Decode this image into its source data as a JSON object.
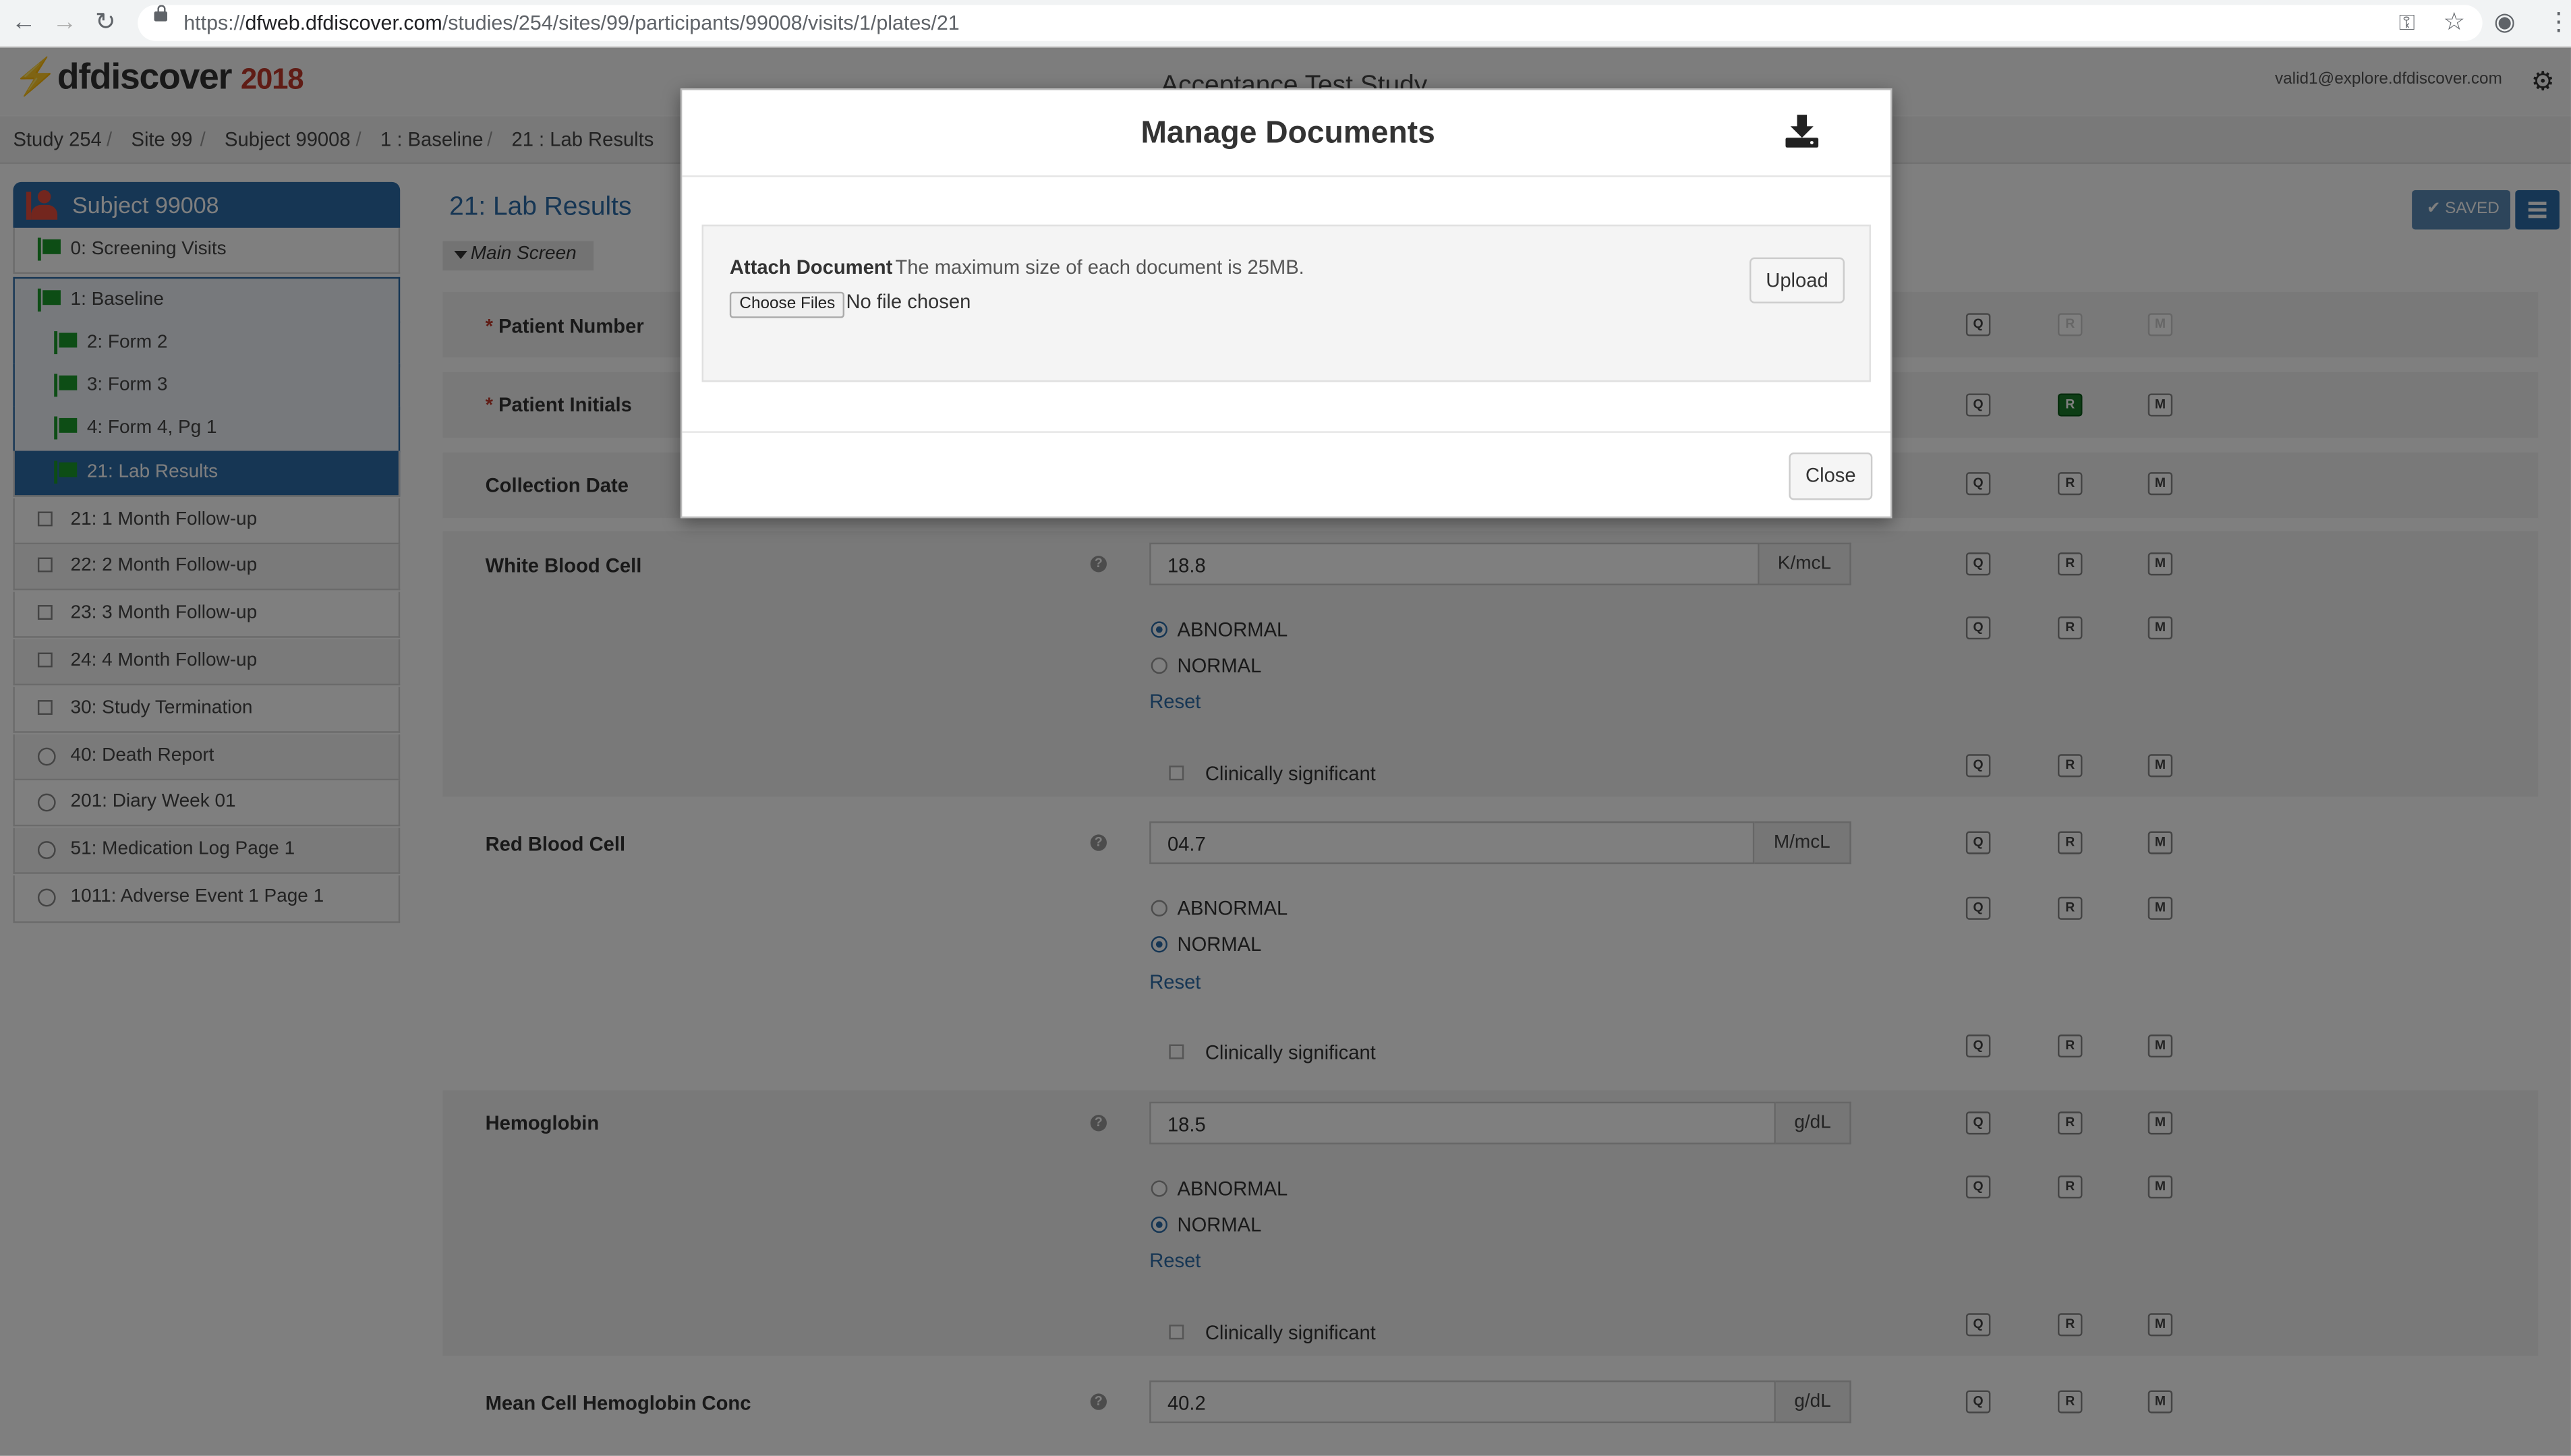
{
  "browser": {
    "url_prefix": "https://",
    "url_host": "dfweb.dfdiscover.com",
    "url_path": "/studies/254/sites/99/participants/99008/visits/1/plates/21",
    "nav": {
      "back": "←",
      "forward": "→",
      "reload": "↻",
      "key": "⚿",
      "star": "☆",
      "account": "◉",
      "more": "⋮"
    }
  },
  "app": {
    "logo": "dfdiscover",
    "logo_year": "2018",
    "study_title": "Acceptance Test Study",
    "user_email": "valid1@explore.dfdiscover.com",
    "gear": "⚙"
  },
  "breadcrumb": [
    "Study 254",
    "Site 99",
    "Subject 99008",
    "1 : Baseline",
    "21 : Lab Results"
  ],
  "breadcrumb_sep": "/",
  "sidebar": {
    "subject": "Subject 99008",
    "items": [
      {
        "label": "0: Screening Visits"
      },
      {
        "label": "1: Baseline"
      },
      {
        "label": "2: Form 2"
      },
      {
        "label": "3: Form 3"
      },
      {
        "label": "4: Form 4, Pg 1"
      },
      {
        "label": "21: Lab Results"
      },
      {
        "label": "21: 1 Month Follow-up"
      },
      {
        "label": "22: 2 Month Follow-up"
      },
      {
        "label": "23: 3 Month Follow-up"
      },
      {
        "label": "24: 4 Month Follow-up"
      },
      {
        "label": "30: Study Termination"
      },
      {
        "label": "40: Death Report"
      },
      {
        "label": "201: Diary Week 01"
      },
      {
        "label": "51: Medication Log Page 1"
      },
      {
        "label": "1011: Adverse Event 1 Page 1"
      }
    ]
  },
  "plate": {
    "title": "21: Lab Results",
    "tab": "Main Screen",
    "saved_label": "✔ SAVED"
  },
  "qrm": {
    "q": "Q",
    "r": "R",
    "m": "M"
  },
  "form": {
    "required_mark": "*",
    "help": "?",
    "patient_number": "Patient Number",
    "patient_initials": "Patient Initials",
    "collection_date": "Collection Date",
    "abnormal": "ABNORMAL",
    "normal": "NORMAL",
    "reset": "Reset",
    "clinically_significant": "Clinically significant",
    "fields": [
      {
        "label": "White Blood Cell",
        "value": "18.8",
        "unit": "K/mcL"
      },
      {
        "label": "Red Blood Cell",
        "value": "04.7",
        "unit": "M/mcL"
      },
      {
        "label": "Hemoglobin",
        "value": "18.5",
        "unit": "g/dL"
      },
      {
        "label": "Mean Cell Hemoglobin Conc",
        "value": "40.2",
        "unit": "g/dL"
      }
    ]
  },
  "modal": {
    "title": "Manage Documents",
    "attach_label": "Attach Document",
    "attach_note": "The maximum size of each document is 25MB.",
    "choose_files": "Choose Files",
    "no_file": "No file chosen",
    "upload": "Upload",
    "close": "Close"
  },
  "colors": {
    "accent": "#2d6ca9",
    "flag_green": "#1a9a2b",
    "required_red": "#c0392b"
  }
}
